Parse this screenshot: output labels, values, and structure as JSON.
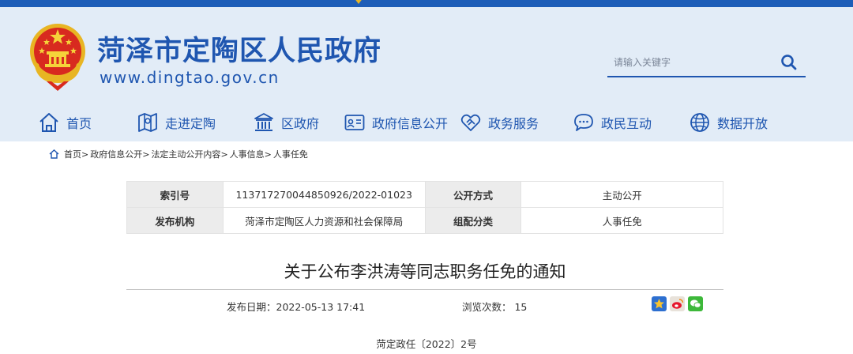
{
  "site": {
    "title": "菏泽市定陶区人民政府",
    "url": "www.dingtao.gov.cn"
  },
  "search": {
    "placeholder": "请输入关键字",
    "icon": "search-icon"
  },
  "nav": [
    {
      "label": "首页",
      "icon": "home-icon"
    },
    {
      "label": "走进定陶",
      "icon": "map-icon"
    },
    {
      "label": "区政府",
      "icon": "government-building-icon"
    },
    {
      "label": "政府信息公开",
      "icon": "info-board-icon"
    },
    {
      "label": "政务服务",
      "icon": "handshake-icon"
    },
    {
      "label": "政民互动",
      "icon": "chat-icon"
    },
    {
      "label": "数据开放",
      "icon": "data-globe-icon"
    }
  ],
  "breadcrumb": [
    "首页",
    "政府信息公开",
    "法定主动公开内容",
    "人事信息",
    "人事任免"
  ],
  "meta": {
    "index_label": "索引号",
    "index_value": "113717270044850926/2022-01023",
    "method_label": "公开方式",
    "method_value": "主动公开",
    "issuer_label": "发布机构",
    "issuer_value": "菏泽市定陶区人力资源和社会保障局",
    "category_label": "组配分类",
    "category_value": "人事任免"
  },
  "article": {
    "title": "关于公布李洪涛等同志职务任免的通知",
    "pubdate": "发布日期：2022-05-13 17:41",
    "views": "浏览次数： 15",
    "doc_no": "菏定政任〔2022〕2号"
  },
  "colors": {
    "brand_blue": "#1f56b0",
    "header_bg": "#e2ecf7",
    "topbar": "#1d5db8"
  }
}
